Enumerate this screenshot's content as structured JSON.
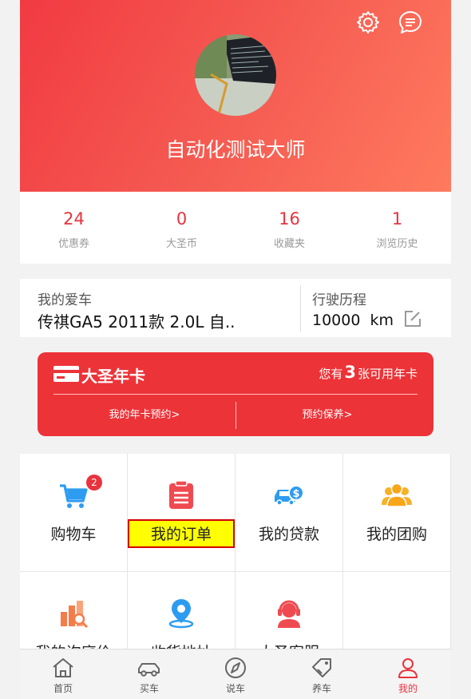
{
  "header": {
    "username": "自动化测试大师",
    "settings_icon": "gear-icon",
    "message_icon": "message-icon"
  },
  "stats": [
    {
      "value": "24",
      "label": "优惠券"
    },
    {
      "value": "0",
      "label": "大圣币"
    },
    {
      "value": "16",
      "label": "收藏夹"
    },
    {
      "value": "1",
      "label": "浏览历史"
    }
  ],
  "car": {
    "label": "我的爱车",
    "value": "传祺GA5 2011款 2.0L 自..",
    "mileage_label": "行驶历程",
    "mileage_value": "10000  km"
  },
  "annual_card": {
    "title": "大圣年卡",
    "avail_prefix": "您有",
    "avail_count": "3",
    "avail_suffix": "张可用年卡",
    "link_left": "我的年卡预约>",
    "link_right": "预约保养>"
  },
  "grid": [
    {
      "label": "购物车",
      "icon": "shopping-cart-icon",
      "badge": "2"
    },
    {
      "label": "我的订单",
      "icon": "clipboard-icon"
    },
    {
      "label": "我的贷款",
      "icon": "car-loan-icon"
    },
    {
      "label": "我的团购",
      "icon": "group-icon"
    },
    {
      "label": "我的询底价",
      "icon": "price-chart-icon"
    },
    {
      "label": "收货地址",
      "icon": "location-pin-icon"
    },
    {
      "label": "大圣客服",
      "icon": "customer-service-icon"
    }
  ],
  "tabs": [
    {
      "label": "首页",
      "icon": "home-icon"
    },
    {
      "label": "买车",
      "icon": "car-icon"
    },
    {
      "label": "说车",
      "icon": "compass-icon"
    },
    {
      "label": "养车",
      "icon": "tag-icon"
    },
    {
      "label": "我的",
      "icon": "user-icon",
      "active": true
    }
  ],
  "colors": {
    "accent": "#e8333e",
    "card": "#ec3338",
    "highlight": "#ffff00"
  }
}
